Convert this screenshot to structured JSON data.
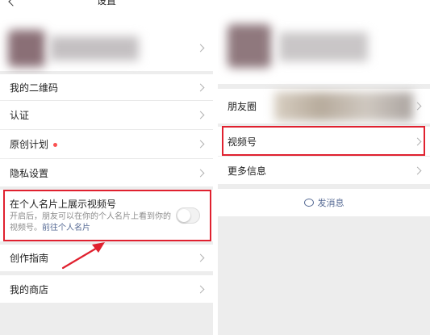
{
  "left": {
    "header_title": "设置",
    "menu": [
      {
        "label": "我的二维码"
      },
      {
        "label": "认证"
      },
      {
        "label": "原创计划"
      },
      {
        "label": "隐私设置"
      }
    ],
    "show_on_card": {
      "title": "在个人名片上展示视频号",
      "desc_prefix": "开启后，朋友可以在你的个人名片上看到你的视频号。",
      "desc_link": "前往个人名片",
      "toggle_on": false
    },
    "creation_guide": "创作指南",
    "my_store": "我的商店"
  },
  "right": {
    "moments": "朋友圈",
    "channels": "视频号",
    "more_info": "更多信息",
    "send_message": "发消息"
  },
  "colors": {
    "highlight": "#e0212f",
    "link": "#576b95",
    "badge_dot": "#fa5151",
    "background": "#ededed"
  }
}
